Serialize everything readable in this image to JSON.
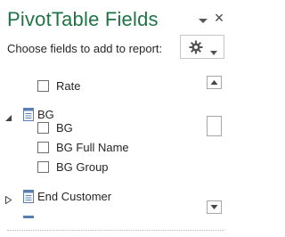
{
  "pane": {
    "title": "PivotTable Fields",
    "subtitle": "Choose fields to add to report:",
    "close_label": "×"
  },
  "fields": [
    {
      "label": "Rate",
      "checked": false
    },
    {
      "label": "BG",
      "type": "table",
      "expanded": true
    },
    {
      "label": "BG",
      "checked": false
    },
    {
      "label": "BG Full Name",
      "checked": false
    },
    {
      "label": "BG Group",
      "checked": false
    },
    {
      "label": "End Customer",
      "type": "table",
      "expanded": false
    }
  ],
  "colors": {
    "title": "#217346",
    "text": "#262626",
    "border": "#a6a6a6"
  }
}
